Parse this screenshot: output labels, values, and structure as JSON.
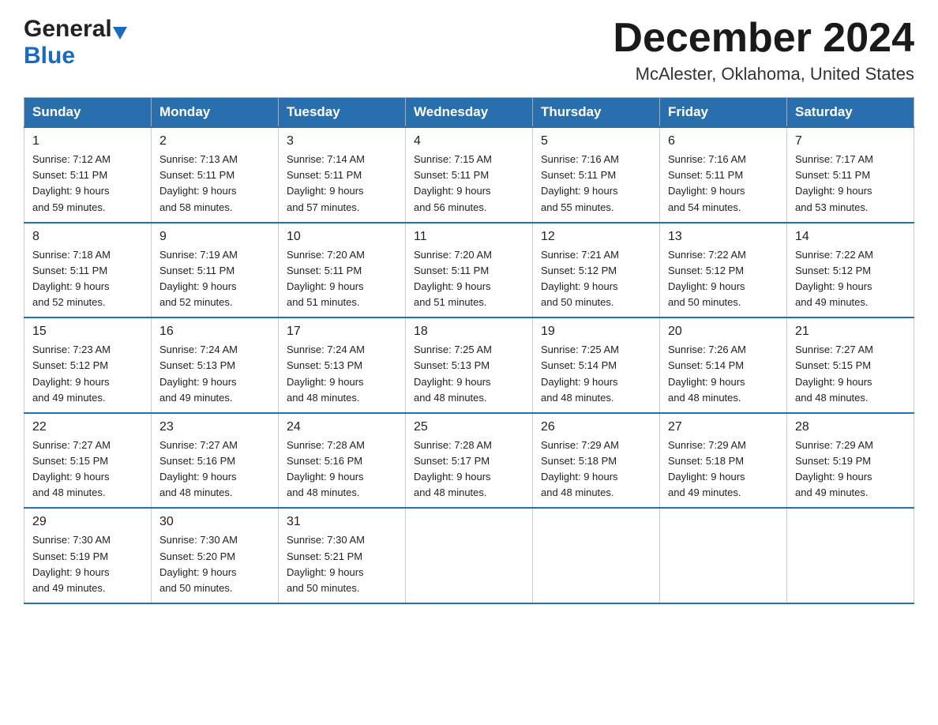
{
  "header": {
    "logo_general": "General",
    "logo_blue": "Blue",
    "month_title": "December 2024",
    "location": "McAlester, Oklahoma, United States"
  },
  "days_of_week": [
    "Sunday",
    "Monday",
    "Tuesday",
    "Wednesday",
    "Thursday",
    "Friday",
    "Saturday"
  ],
  "weeks": [
    [
      {
        "day": "1",
        "sunrise": "7:12 AM",
        "sunset": "5:11 PM",
        "daylight": "9 hours and 59 minutes."
      },
      {
        "day": "2",
        "sunrise": "7:13 AM",
        "sunset": "5:11 PM",
        "daylight": "9 hours and 58 minutes."
      },
      {
        "day": "3",
        "sunrise": "7:14 AM",
        "sunset": "5:11 PM",
        "daylight": "9 hours and 57 minutes."
      },
      {
        "day": "4",
        "sunrise": "7:15 AM",
        "sunset": "5:11 PM",
        "daylight": "9 hours and 56 minutes."
      },
      {
        "day": "5",
        "sunrise": "7:16 AM",
        "sunset": "5:11 PM",
        "daylight": "9 hours and 55 minutes."
      },
      {
        "day": "6",
        "sunrise": "7:16 AM",
        "sunset": "5:11 PM",
        "daylight": "9 hours and 54 minutes."
      },
      {
        "day": "7",
        "sunrise": "7:17 AM",
        "sunset": "5:11 PM",
        "daylight": "9 hours and 53 minutes."
      }
    ],
    [
      {
        "day": "8",
        "sunrise": "7:18 AM",
        "sunset": "5:11 PM",
        "daylight": "9 hours and 52 minutes."
      },
      {
        "day": "9",
        "sunrise": "7:19 AM",
        "sunset": "5:11 PM",
        "daylight": "9 hours and 52 minutes."
      },
      {
        "day": "10",
        "sunrise": "7:20 AM",
        "sunset": "5:11 PM",
        "daylight": "9 hours and 51 minutes."
      },
      {
        "day": "11",
        "sunrise": "7:20 AM",
        "sunset": "5:11 PM",
        "daylight": "9 hours and 51 minutes."
      },
      {
        "day": "12",
        "sunrise": "7:21 AM",
        "sunset": "5:12 PM",
        "daylight": "9 hours and 50 minutes."
      },
      {
        "day": "13",
        "sunrise": "7:22 AM",
        "sunset": "5:12 PM",
        "daylight": "9 hours and 50 minutes."
      },
      {
        "day": "14",
        "sunrise": "7:22 AM",
        "sunset": "5:12 PM",
        "daylight": "9 hours and 49 minutes."
      }
    ],
    [
      {
        "day": "15",
        "sunrise": "7:23 AM",
        "sunset": "5:12 PM",
        "daylight": "9 hours and 49 minutes."
      },
      {
        "day": "16",
        "sunrise": "7:24 AM",
        "sunset": "5:13 PM",
        "daylight": "9 hours and 49 minutes."
      },
      {
        "day": "17",
        "sunrise": "7:24 AM",
        "sunset": "5:13 PM",
        "daylight": "9 hours and 48 minutes."
      },
      {
        "day": "18",
        "sunrise": "7:25 AM",
        "sunset": "5:13 PM",
        "daylight": "9 hours and 48 minutes."
      },
      {
        "day": "19",
        "sunrise": "7:25 AM",
        "sunset": "5:14 PM",
        "daylight": "9 hours and 48 minutes."
      },
      {
        "day": "20",
        "sunrise": "7:26 AM",
        "sunset": "5:14 PM",
        "daylight": "9 hours and 48 minutes."
      },
      {
        "day": "21",
        "sunrise": "7:27 AM",
        "sunset": "5:15 PM",
        "daylight": "9 hours and 48 minutes."
      }
    ],
    [
      {
        "day": "22",
        "sunrise": "7:27 AM",
        "sunset": "5:15 PM",
        "daylight": "9 hours and 48 minutes."
      },
      {
        "day": "23",
        "sunrise": "7:27 AM",
        "sunset": "5:16 PM",
        "daylight": "9 hours and 48 minutes."
      },
      {
        "day": "24",
        "sunrise": "7:28 AM",
        "sunset": "5:16 PM",
        "daylight": "9 hours and 48 minutes."
      },
      {
        "day": "25",
        "sunrise": "7:28 AM",
        "sunset": "5:17 PM",
        "daylight": "9 hours and 48 minutes."
      },
      {
        "day": "26",
        "sunrise": "7:29 AM",
        "sunset": "5:18 PM",
        "daylight": "9 hours and 48 minutes."
      },
      {
        "day": "27",
        "sunrise": "7:29 AM",
        "sunset": "5:18 PM",
        "daylight": "9 hours and 49 minutes."
      },
      {
        "day": "28",
        "sunrise": "7:29 AM",
        "sunset": "5:19 PM",
        "daylight": "9 hours and 49 minutes."
      }
    ],
    [
      {
        "day": "29",
        "sunrise": "7:30 AM",
        "sunset": "5:19 PM",
        "daylight": "9 hours and 49 minutes."
      },
      {
        "day": "30",
        "sunrise": "7:30 AM",
        "sunset": "5:20 PM",
        "daylight": "9 hours and 50 minutes."
      },
      {
        "day": "31",
        "sunrise": "7:30 AM",
        "sunset": "5:21 PM",
        "daylight": "9 hours and 50 minutes."
      },
      null,
      null,
      null,
      null
    ]
  ],
  "labels": {
    "sunrise": "Sunrise:",
    "sunset": "Sunset:",
    "daylight": "Daylight:"
  }
}
